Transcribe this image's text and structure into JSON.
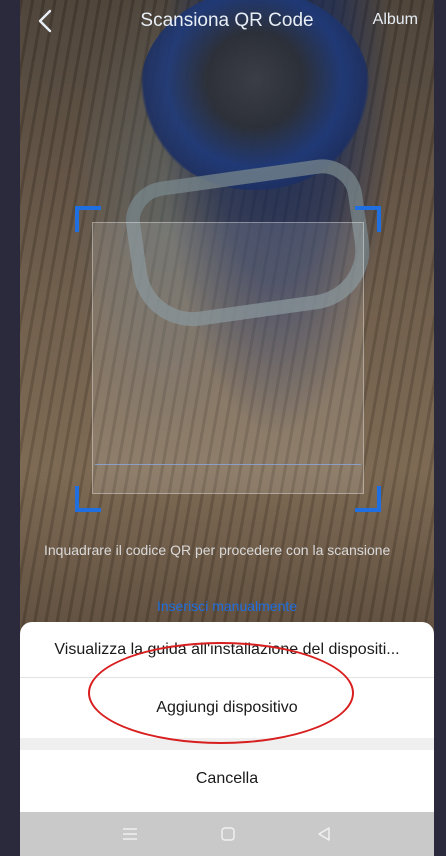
{
  "header": {
    "title": "Scansiona QR Code",
    "album_label": "Album"
  },
  "scanner": {
    "hint": "Inquadrare il codice QR per procedere con la scansione",
    "manual_entry_label": "Inserisci manualmente"
  },
  "action_sheet": {
    "items": [
      {
        "label": "Visualizza la guida all'installazione del dispositi..."
      },
      {
        "label": "Aggiungi dispositivo"
      },
      {
        "label": "Cancella"
      }
    ]
  },
  "navbar": {
    "icons": [
      "menu-icon",
      "home-icon",
      "back-triangle-icon"
    ]
  },
  "colors": {
    "accent": "#1f6fe0",
    "annotation": "#d81e1e"
  }
}
